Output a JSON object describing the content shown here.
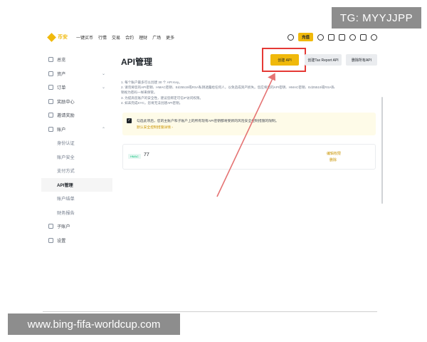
{
  "overlay": {
    "tg_label": "TG: MYYJJPP",
    "watermark": "www.bing-fifa-worldcup.com"
  },
  "topnav": {
    "logo_text": "币安",
    "items": [
      "一键买币",
      "行情",
      "交易",
      "合约",
      "理财",
      "广场",
      "更多"
    ],
    "deposit_label": "充值"
  },
  "sidebar": {
    "items": [
      {
        "label": "总览"
      },
      {
        "label": "资产"
      },
      {
        "label": "订单"
      },
      {
        "label": "奖励中心"
      },
      {
        "label": "邀请奖励"
      },
      {
        "label": "账户"
      }
    ],
    "account_sub": [
      {
        "label": "身份认证"
      },
      {
        "label": "账户安全"
      },
      {
        "label": "支付方式"
      },
      {
        "label": "API管理"
      },
      {
        "label": "账户结单"
      },
      {
        "label": "财务报告"
      }
    ],
    "bottom_items": [
      {
        "label": "子账户"
      },
      {
        "label": "设置"
      }
    ]
  },
  "main": {
    "title": "API管理",
    "create_button": "创建 API",
    "tax_button": "创建Tax Report API",
    "delete_all_button": "删除所有API",
    "notes": [
      "1. 每个账户最多可以创建 30 个 API Key。",
      "2. 请勿将您的API密钥、HMAC密钥、Ed25519或RSA私钥透露给任何人，以免造成资产损失。您应将您的API密钥、HMAC密钥、Ed25519或RSA私",
      "钥视为密码一样来保管。",
      "3. 为提高您账户的安全性，建议您绑定可信IP访问权限。",
      "4. 如未完成KYC，您将无法创建API密钥。"
    ],
    "warning_text": "勾选此项后，您的主账户和子账户上的所有现有API密钥都将受新的风险安全控制措施的限制。",
    "warning_link": "默认安全控制措施详情 ›",
    "api_card": {
      "tag": "HMAC",
      "label": "77",
      "edit": "编辑权限",
      "delete": "删除"
    }
  }
}
